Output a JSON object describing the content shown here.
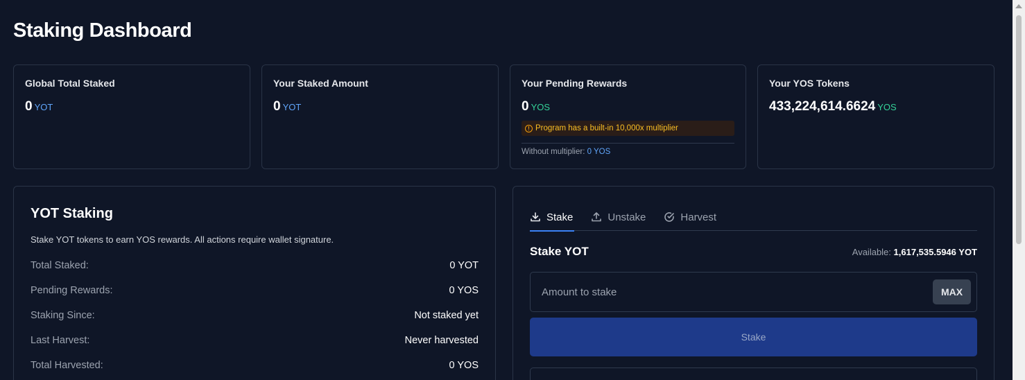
{
  "page": {
    "title": "Staking Dashboard"
  },
  "stats": [
    {
      "label": "Global Total Staked",
      "value": "0",
      "unit": "YOT"
    },
    {
      "label": "Your Staked Amount",
      "value": "0",
      "unit": "YOT"
    },
    {
      "label": "Your Pending Rewards",
      "value": "0",
      "unit": "YOS",
      "warning": "Program has a built-in 10,000x multiplier",
      "note_label": "Without multiplier:",
      "note_value": "0 YOS"
    },
    {
      "label": "Your YOS Tokens",
      "value": "433,224,614.6624",
      "unit": "YOS"
    }
  ],
  "staking": {
    "title": "YOT Staking",
    "description": "Stake YOT tokens to earn YOS rewards. All actions require wallet signature.",
    "rows": [
      {
        "label": "Total Staked:",
        "value": "0 YOT"
      },
      {
        "label": "Pending Rewards:",
        "value": "0 YOS"
      },
      {
        "label": "Staking Since:",
        "value": "Not staked yet"
      },
      {
        "label": "Last Harvest:",
        "value": "Never harvested"
      },
      {
        "label": "Total Harvested:",
        "value": "0 YOS"
      }
    ]
  },
  "actions": {
    "tabs": [
      {
        "label": "Stake",
        "icon": "download-icon",
        "active": true
      },
      {
        "label": "Unstake",
        "icon": "upload-icon",
        "active": false
      },
      {
        "label": "Harvest",
        "icon": "check-circle-icon",
        "active": false
      }
    ],
    "stake_title": "Stake YOT",
    "available_label": "Available:",
    "available_value": "1,617,535.5946 YOT",
    "amount_placeholder": "Amount to stake",
    "max_label": "MAX",
    "stake_button": "Stake"
  },
  "colors": {
    "accent": "#3b82f6",
    "yot": "#60a5fa",
    "yos": "#34d399",
    "warning": "#fbbf24",
    "button": "#1e3a8a"
  }
}
